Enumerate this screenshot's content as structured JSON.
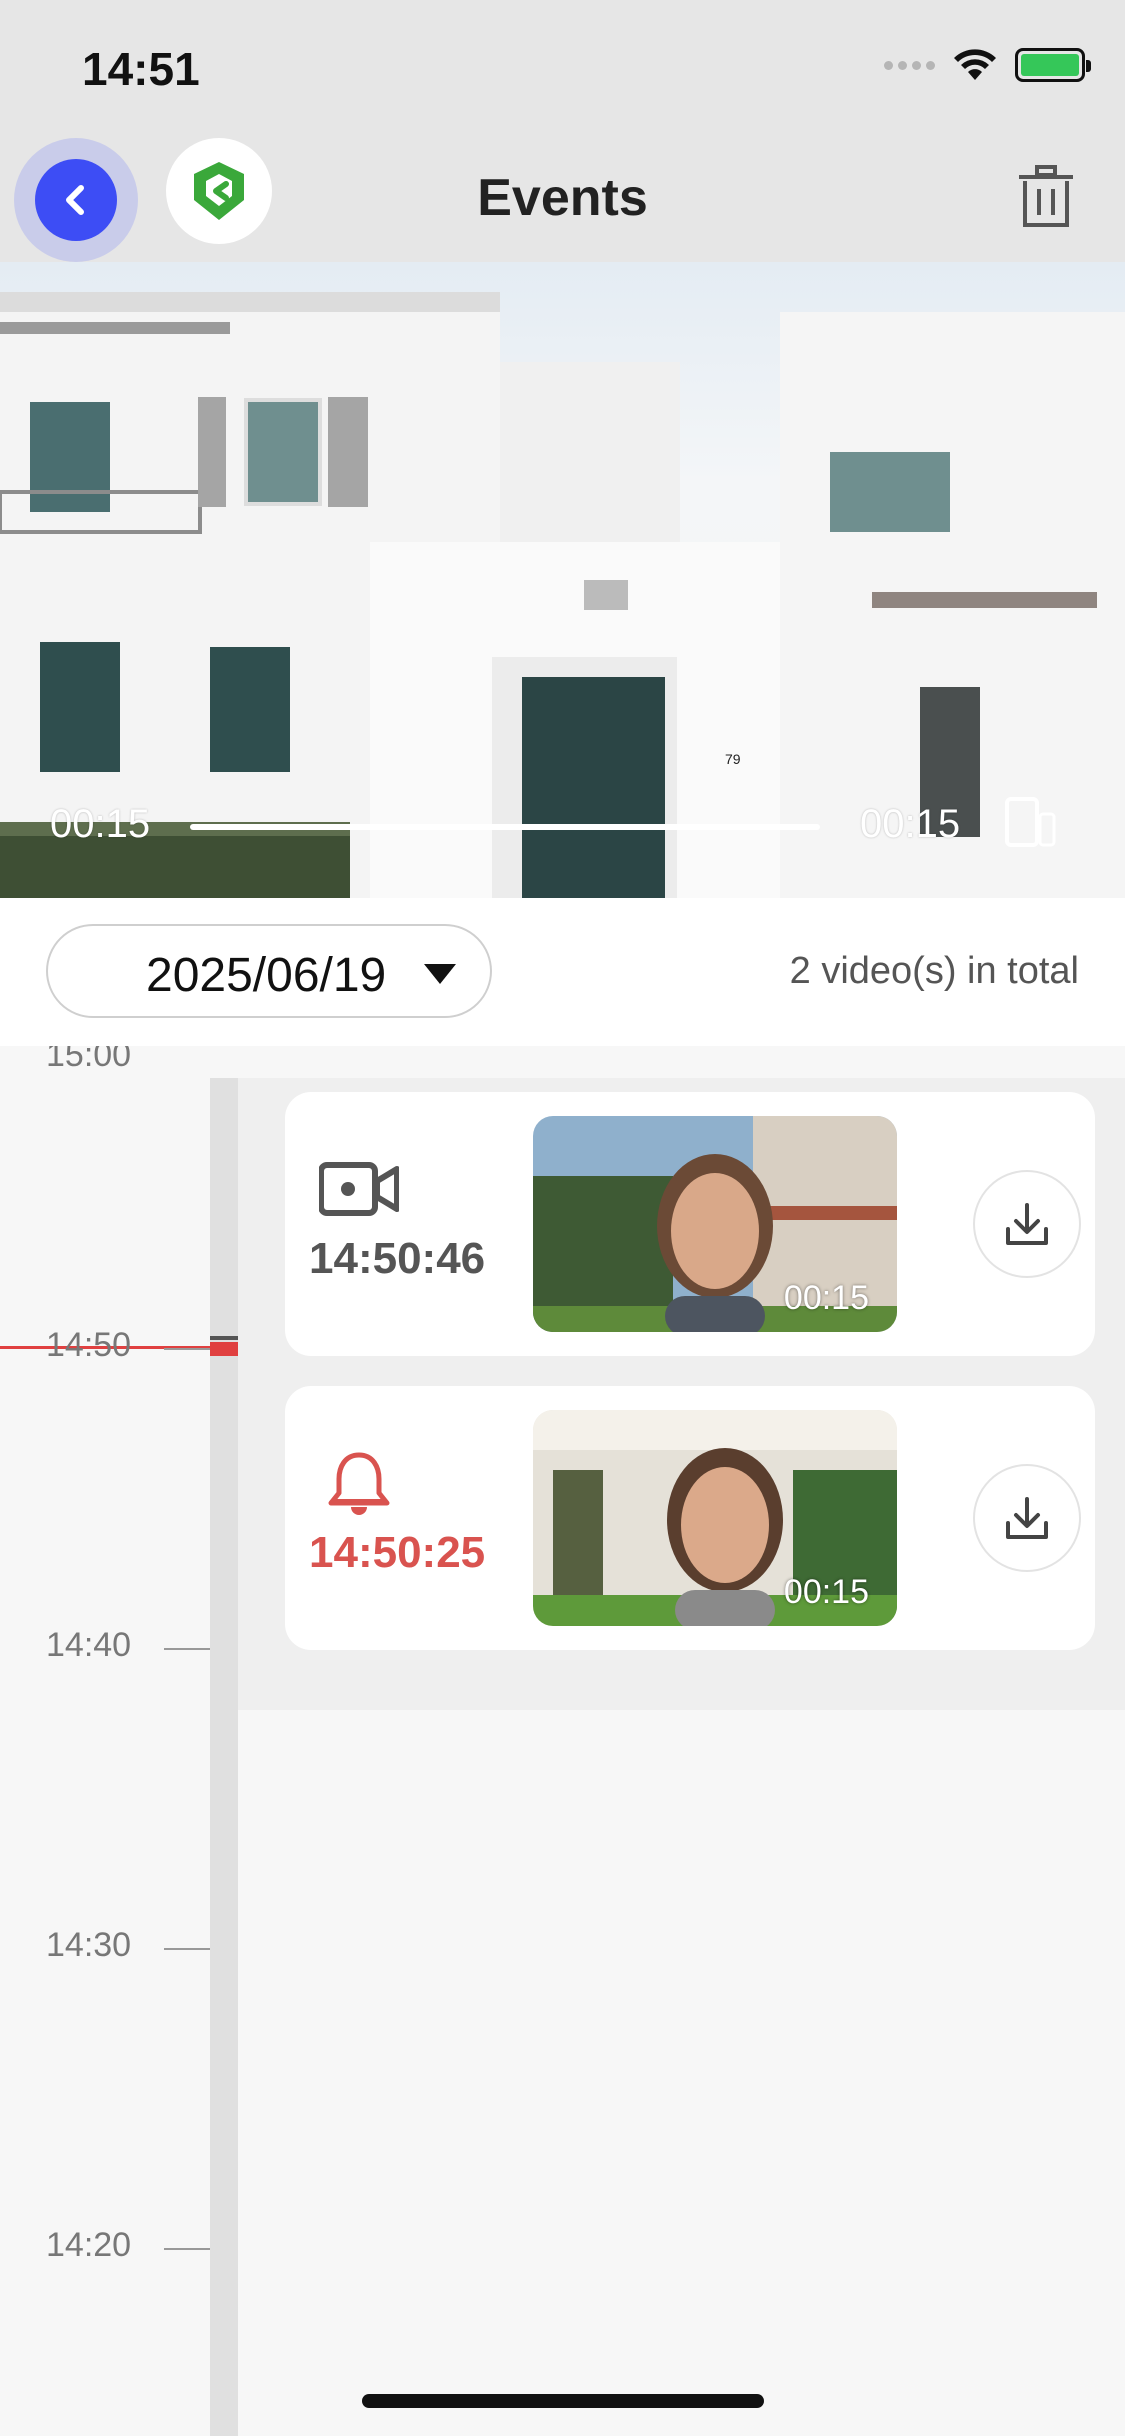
{
  "status_bar": {
    "time": "14:51"
  },
  "header": {
    "title": "Events"
  },
  "player": {
    "current_time": "00:15",
    "duration": "00:15",
    "house_number": "79"
  },
  "filter": {
    "date": "2025/06/19",
    "total_label": "2 video(s) in total"
  },
  "timeline": {
    "ticks": [
      "14:50",
      "14:40",
      "14:30",
      "14:20"
    ],
    "top_partial_tick": "15:00"
  },
  "events": [
    {
      "type": "video-recording",
      "time": "14:50:46",
      "duration": "00:15",
      "color": "#555555"
    },
    {
      "type": "doorbell-ring",
      "time": "14:50:25",
      "duration": "00:15",
      "color": "#d9534f"
    }
  ],
  "colors": {
    "accent_blue": "#3d4df5",
    "alert_red": "#e04040",
    "brand_green": "#3aa83a"
  }
}
